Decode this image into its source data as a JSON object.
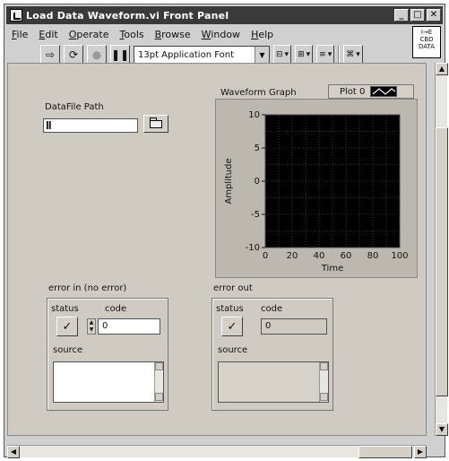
{
  "window": {
    "title": "Load Data Waveform.vi Front Panel",
    "min_label": "_",
    "max_label": "□",
    "close_label": "✕"
  },
  "menu": [
    "File",
    "Edit",
    "Operate",
    "Tools",
    "Browse",
    "Window",
    "Help"
  ],
  "toolbar": {
    "run_icon": "⇨",
    "continuous_icon": "⟳",
    "abort_icon": "●",
    "pause_icon": "❚❚",
    "font_label": "13pt Application Font",
    "align_icon": "align-objects-icon",
    "distribute_icon": "distribute-objects-icon",
    "reorder_icon": "reorder-icon",
    "resize_icon": "resize-icon"
  },
  "connector": {
    "line1": "I→E",
    "line2": "CBD",
    "line3": "DATA"
  },
  "datafile": {
    "label": "DataFile Path",
    "value": "",
    "mark": "ǁ"
  },
  "graph": {
    "title": "Waveform Graph",
    "legend_label": "Plot 0",
    "xlabel": "Time",
    "ylabel": "Amplitude",
    "xticks": [
      "0",
      "20",
      "40",
      "60",
      "80",
      "100"
    ],
    "yticks": [
      "10",
      "5",
      "0",
      "-5",
      "-10"
    ]
  },
  "error_in": {
    "label": "error in (no error)",
    "status_label": "status",
    "code_label": "code",
    "code_value": "0",
    "source_label": "source",
    "source_value": ""
  },
  "error_out": {
    "label": "error out",
    "status_label": "status",
    "code_label": "code",
    "code_value": "0",
    "source_label": "source",
    "source_value": ""
  },
  "chart_data": {
    "type": "line",
    "x": [],
    "series": [],
    "xlabel": "Time",
    "ylabel": "Amplitude",
    "xlim": [
      0,
      100
    ],
    "ylim": [
      -10,
      10
    ],
    "grid": true
  }
}
